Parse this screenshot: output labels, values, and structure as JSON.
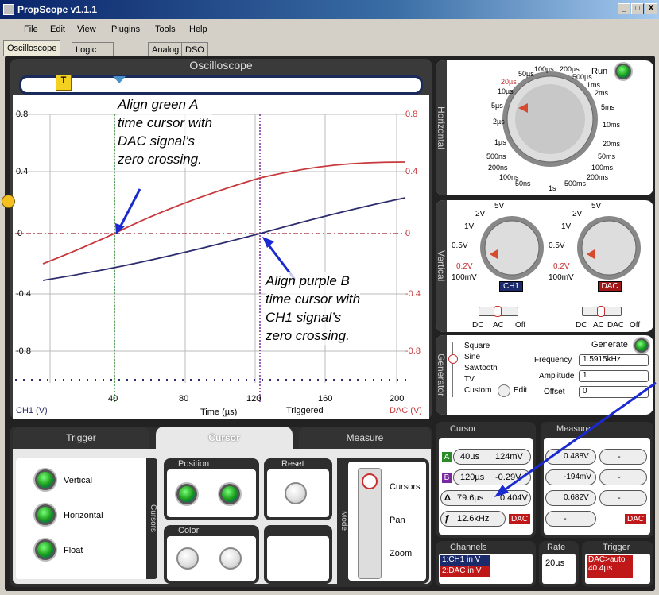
{
  "window": {
    "title": "PropScope v1.1.1",
    "min": "_",
    "max": "□",
    "close": "X"
  },
  "menu": [
    "File",
    "Edit",
    "View",
    "Plugins",
    "Tools",
    "Help"
  ],
  "tabs": [
    "Oscilloscope",
    "Logic Analyzer",
    "Analog",
    "DSO LSA"
  ],
  "scope": {
    "title": "Oscilloscope",
    "left_labels": [
      "0.8",
      "0.4",
      "0",
      "-0.4",
      "-0.8"
    ],
    "right_labels": [
      "0.8",
      "0.4",
      "0",
      "-0.4",
      "-0.8"
    ],
    "x_ticks": [
      "40",
      "80",
      "120",
      "160",
      "200"
    ],
    "x_label": "Time (µs)",
    "status": "Triggered",
    "left_ch": "CH1 (V)",
    "right_ch": "DAC (V)",
    "annotation_a": [
      "Align green A",
      "time cursor with",
      "DAC signal’s",
      "zero crossing."
    ],
    "annotation_b": [
      "Align purple B",
      "time cursor with",
      "CH1 signal’s",
      "zero crossing."
    ],
    "trigger_marker": "T"
  },
  "horizontal": {
    "label": "Horizontal",
    "run": "Run",
    "dial": [
      "100µs",
      "200µs",
      "500µs",
      "50µs",
      "20µs",
      "10µs",
      "1ms",
      "2ms",
      "5µs",
      "5ms",
      "2µs",
      "10ms",
      "1µs",
      "20ms",
      "500ns",
      "50ms",
      "200ns",
      "100ms",
      "100ns",
      "200ms",
      "50ns",
      "1s",
      "500ms"
    ]
  },
  "vertical": {
    "label": "Vertical",
    "dial": [
      "5V",
      "2V",
      "1V",
      "0.5V",
      "0.2V",
      "100mV"
    ],
    "ch1": "CH1",
    "dac": "DAC",
    "modes1": [
      "DC",
      "AC",
      "Off"
    ],
    "modes2": [
      "DC",
      "AC",
      "DAC",
      "Off"
    ]
  },
  "generator": {
    "label": "Generator",
    "waves": [
      "Square",
      "Sine",
      "Sawtooth",
      "TV",
      "Custom"
    ],
    "edit": "Edit",
    "generate": "Generate",
    "freq_label": "Frequency",
    "freq": "1.5915kHz",
    "amp_label": "Amplitude",
    "amp": "1",
    "off_label": "Offset",
    "off": "0"
  },
  "bottom": {
    "tabs": [
      "Trigger",
      "Cursor",
      "Measure"
    ],
    "modes": [
      "Vertical",
      "Horizontal",
      "Float"
    ],
    "cursors_side": "Cursors",
    "position": "Position",
    "reset": "Reset",
    "color": "Color",
    "mode_side": "Mode",
    "mode_opts": [
      "Cursors",
      "Pan",
      "Zoom"
    ]
  },
  "cursor": {
    "title": "Cursor",
    "a": [
      "40µs",
      "124mV"
    ],
    "b": [
      "120µs",
      "-0.29V"
    ],
    "delta": [
      "79.6µs",
      "0.404V"
    ],
    "freq": "12.6kHz",
    "dac": "DAC",
    "la": "A",
    "lb": "B",
    "ld": "Δ",
    "lf": "ƒ"
  },
  "measure": {
    "title": "Measure",
    "v1": "0.488V",
    "v2": "-194mV",
    "v3": "0.682V",
    "v4": "-",
    "dac": "DAC"
  },
  "channels": {
    "title": "Channels",
    "c1": "1:CH1 in V",
    "c2": "2:DAC in V"
  },
  "rate": {
    "title": "Rate",
    "val": "20µs"
  },
  "trigger": {
    "title": "Trigger",
    "l1": "DAC>auto",
    "l2": "40.4µs"
  },
  "colors": {
    "ch1": "#2c2c6e",
    "dac": "#c8383c",
    "cursorA": "#2a8a2a",
    "cursorB": "#7a2aa0"
  }
}
